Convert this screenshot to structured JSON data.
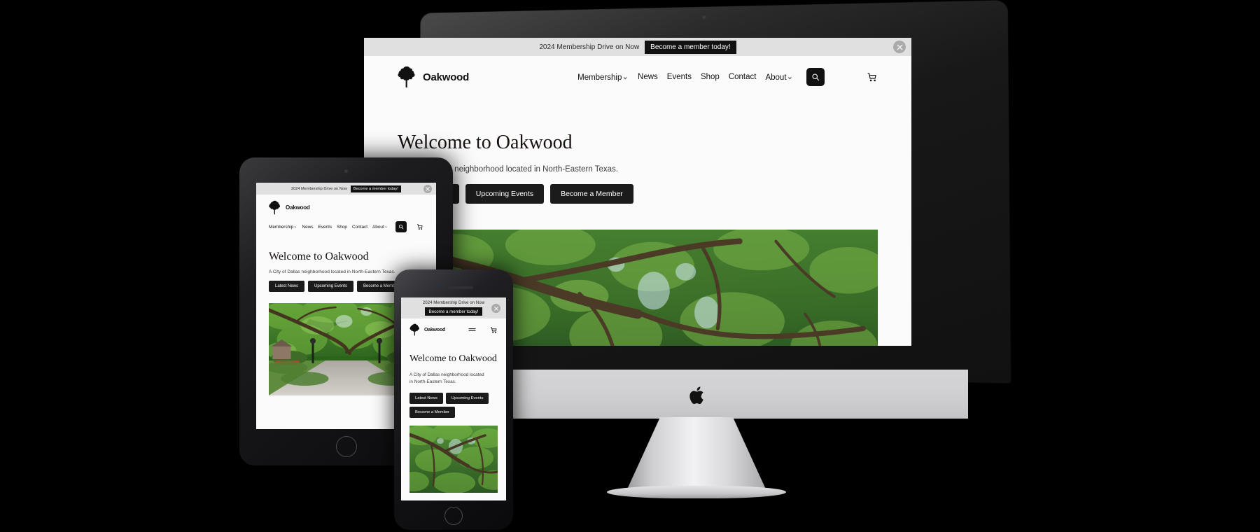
{
  "site": {
    "promo": {
      "text": "2024 Membership Drive on Now",
      "button_label": "Become a member today!",
      "close_icon": "close-icon",
      "background": "#e0e0e0"
    },
    "brand": {
      "name": "Oakwood",
      "logo_icon": "oak-tree-icon"
    },
    "nav": {
      "items": [
        {
          "label": "Membership",
          "has_dropdown": true
        },
        {
          "label": "News",
          "has_dropdown": false
        },
        {
          "label": "Events",
          "has_dropdown": false
        },
        {
          "label": "Shop",
          "has_dropdown": false
        },
        {
          "label": "Contact",
          "has_dropdown": false
        },
        {
          "label": "About",
          "has_dropdown": true
        }
      ],
      "search_icon": "search-icon",
      "cart_icon": "shopping-cart-icon",
      "menu_icon": "hamburger-menu-icon"
    },
    "hero": {
      "title": "Welcome to Oakwood",
      "subtitle": "A City of Dallas neighborhood located in North-Eastern Texas.",
      "buttons": [
        {
          "label": "Latest News"
        },
        {
          "label": "Upcoming Events"
        },
        {
          "label": "Become a Member"
        }
      ],
      "image_alt": "oak-tree-canopy-photo"
    },
    "colors": {
      "page_background": "#fbfbfb",
      "promo_background": "#e0e0e0",
      "button_background": "#1b1b1b",
      "button_text": "#ffffff",
      "text_primary": "#16110f",
      "text_secondary": "#3b3b3b"
    }
  },
  "devices": {
    "desktop": {
      "name": "imac-desktop",
      "apple_logo": "apple-logo-icon"
    },
    "tablet": {
      "name": "ipad-tablet",
      "home_button": "home-button"
    },
    "phone": {
      "name": "iphone-phone",
      "home_button": "home-button"
    }
  },
  "canvas": {
    "background": "#000000"
  }
}
